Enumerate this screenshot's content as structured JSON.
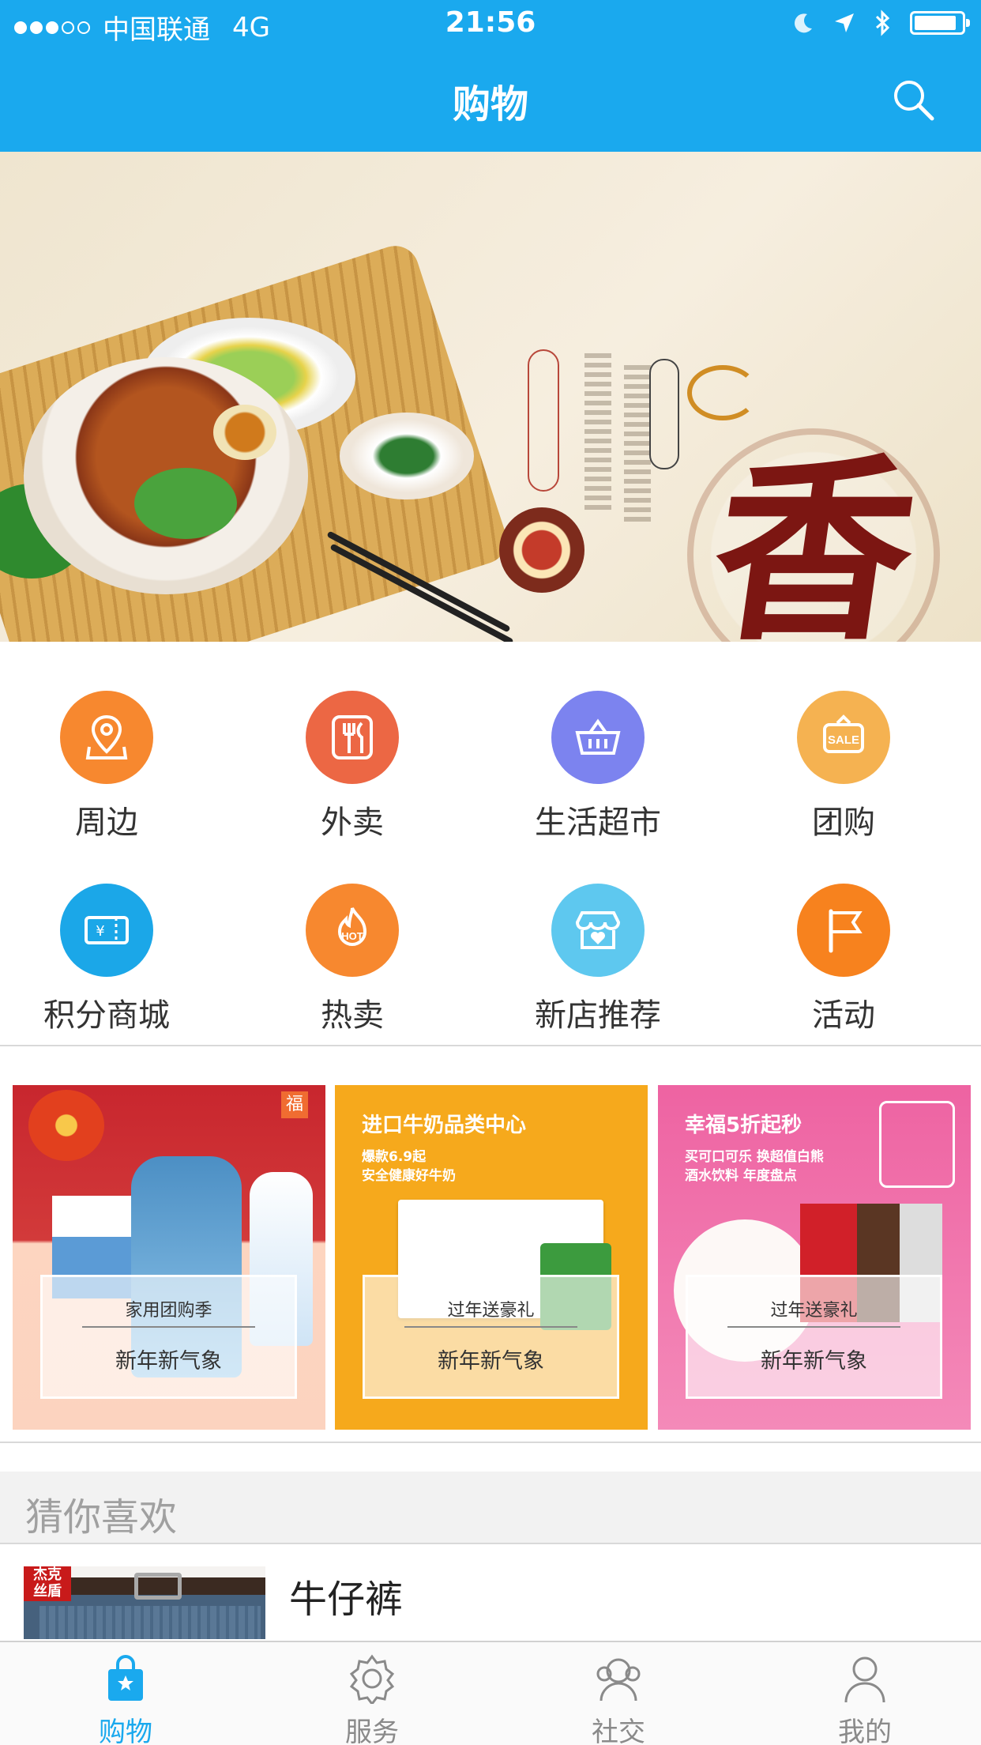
{
  "status_bar": {
    "carrier": "中国联通",
    "network": "4G",
    "time": "21:56"
  },
  "header": {
    "title": "购物",
    "search_icon": "search-icon"
  },
  "banner": {
    "big_character": "香",
    "page_indicator": {
      "total": 1,
      "active": 1
    },
    "indicator_color": "#e4161f"
  },
  "categories": [
    {
      "label": "周边",
      "icon": "location-pin-icon",
      "color": "#f7882f"
    },
    {
      "label": "外卖",
      "icon": "fork-knife-icon",
      "color": "#ec6744"
    },
    {
      "label": "生活超市",
      "icon": "basket-icon",
      "color": "#7c83ef"
    },
    {
      "label": "团购",
      "icon": "sale-tag-icon",
      "color": "#f5b251"
    },
    {
      "label": "积分商城",
      "icon": "ticket-icon",
      "color": "#1ba7e8"
    },
    {
      "label": "热卖",
      "icon": "hot-flame-icon",
      "color": "#f7882f"
    },
    {
      "label": "新店推荐",
      "icon": "store-heart-icon",
      "color": "#5ec8ef"
    },
    {
      "label": "活动",
      "icon": "flag-icon",
      "color": "#f7821e"
    }
  ],
  "promos": [
    {
      "heading": "",
      "subtext": "",
      "overlay_top": "家用团购季",
      "overlay_bottom": "新年新气象",
      "bg": "#c8262e"
    },
    {
      "heading": "进口牛奶品类中心",
      "subtext": "爆款6.9起\n安全健康好牛奶",
      "overlay_top": "过年送豪礼",
      "overlay_bottom": "新年新气象",
      "bg": "#f6a91c"
    },
    {
      "heading": "幸福5折起秒",
      "subtext": "买可口可乐 换超值白熊\n酒水饮料 年度盘点",
      "overlay_top": "过年送豪礼",
      "overlay_bottom": "新年新气象",
      "bg": "#f067a6"
    }
  ],
  "guess_section": {
    "title": "猜你喜欢",
    "items": [
      {
        "title": "牛仔裤",
        "brand_badge": "杰克\n丝盾"
      }
    ]
  },
  "tab_bar": {
    "tabs": [
      {
        "label": "购物",
        "icon": "shopping-bag-icon",
        "active": true
      },
      {
        "label": "服务",
        "icon": "service-gear-icon",
        "active": false
      },
      {
        "label": "社交",
        "icon": "social-people-icon",
        "active": false
      },
      {
        "label": "我的",
        "icon": "profile-person-icon",
        "active": false
      }
    ],
    "active_color": "#1aa9ee",
    "inactive_color": "#8a8a8a"
  }
}
